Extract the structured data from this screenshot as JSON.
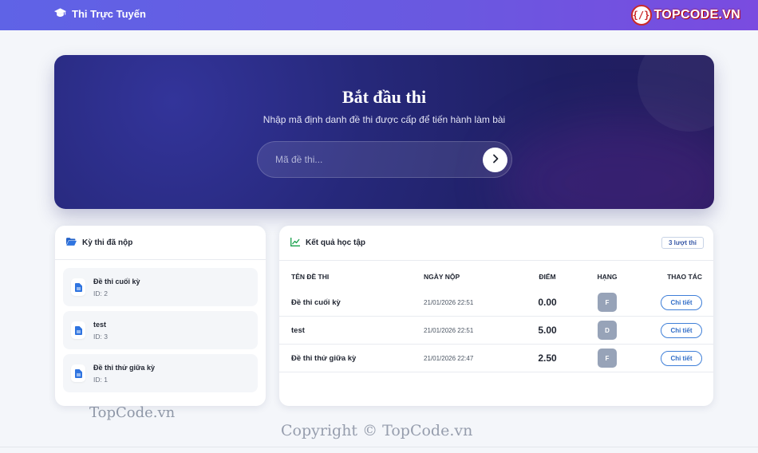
{
  "header": {
    "brand_title": "Thi Trực Tuyến",
    "logo_text": "TOPCODE.VN",
    "logo_mark": "{/}"
  },
  "hero": {
    "title": "Bắt đầu thi",
    "subtitle": "Nhập mã định danh đề thi được cấp để tiến hành làm bài",
    "input_placeholder": "Mã đề thi...",
    "input_value": ""
  },
  "submitted": {
    "title": "Kỳ thi đã nộp",
    "items": [
      {
        "name": "Đề thi cuối kỳ",
        "id": "ID: 2"
      },
      {
        "name": "test",
        "id": "ID: 3"
      },
      {
        "name": "Đề thi thử giữa kỳ",
        "id": "ID: 1"
      }
    ]
  },
  "results": {
    "title": "Kết quả học tập",
    "count_badge": "3 lượt thi",
    "columns": [
      "TÊN ĐỀ THI",
      "NGÀY NỘP",
      "ĐIỂM",
      "HẠNG",
      "THAO TÁC"
    ],
    "rows": [
      {
        "name": "Đề thi cuối kỳ",
        "date": "21/01/2026 22:51",
        "score": "0.00",
        "grade": "F",
        "action": "Chi tiết"
      },
      {
        "name": "test",
        "date": "21/01/2026 22:51",
        "score": "5.00",
        "grade": "D",
        "action": "Chi tiết"
      },
      {
        "name": "Đề thi thử giữa kỳ",
        "date": "21/01/2026 22:47",
        "score": "2.50",
        "grade": "F",
        "action": "Chi tiết"
      }
    ]
  },
  "watermarks": {
    "left": "TopCode.vn",
    "bottom": "Copyright © TopCode.vn"
  },
  "colors": {
    "header_gradient_start": "#5f63e6",
    "header_gradient_end": "#7a4be0",
    "hero_background": "#26287a",
    "grade_badge": "#97a3b8",
    "detail_button": "#3f7fd8"
  },
  "icons": {
    "brand": "graduation-cap-icon",
    "submit": "chevron-right-icon",
    "submitted_header": "folder-open-icon",
    "results_header": "line-chart-icon",
    "exam_item": "document-icon"
  }
}
